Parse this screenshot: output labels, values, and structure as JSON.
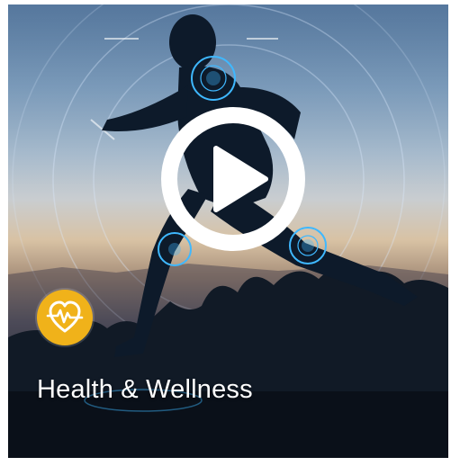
{
  "card": {
    "title": "Health & Wellness",
    "badge_icon": "heart-pulse-icon",
    "play_icon": "play-icon"
  },
  "colors": {
    "badge": "#f0b21a",
    "hud_accent": "#3fb8ff",
    "title_text": "#ffffff"
  }
}
